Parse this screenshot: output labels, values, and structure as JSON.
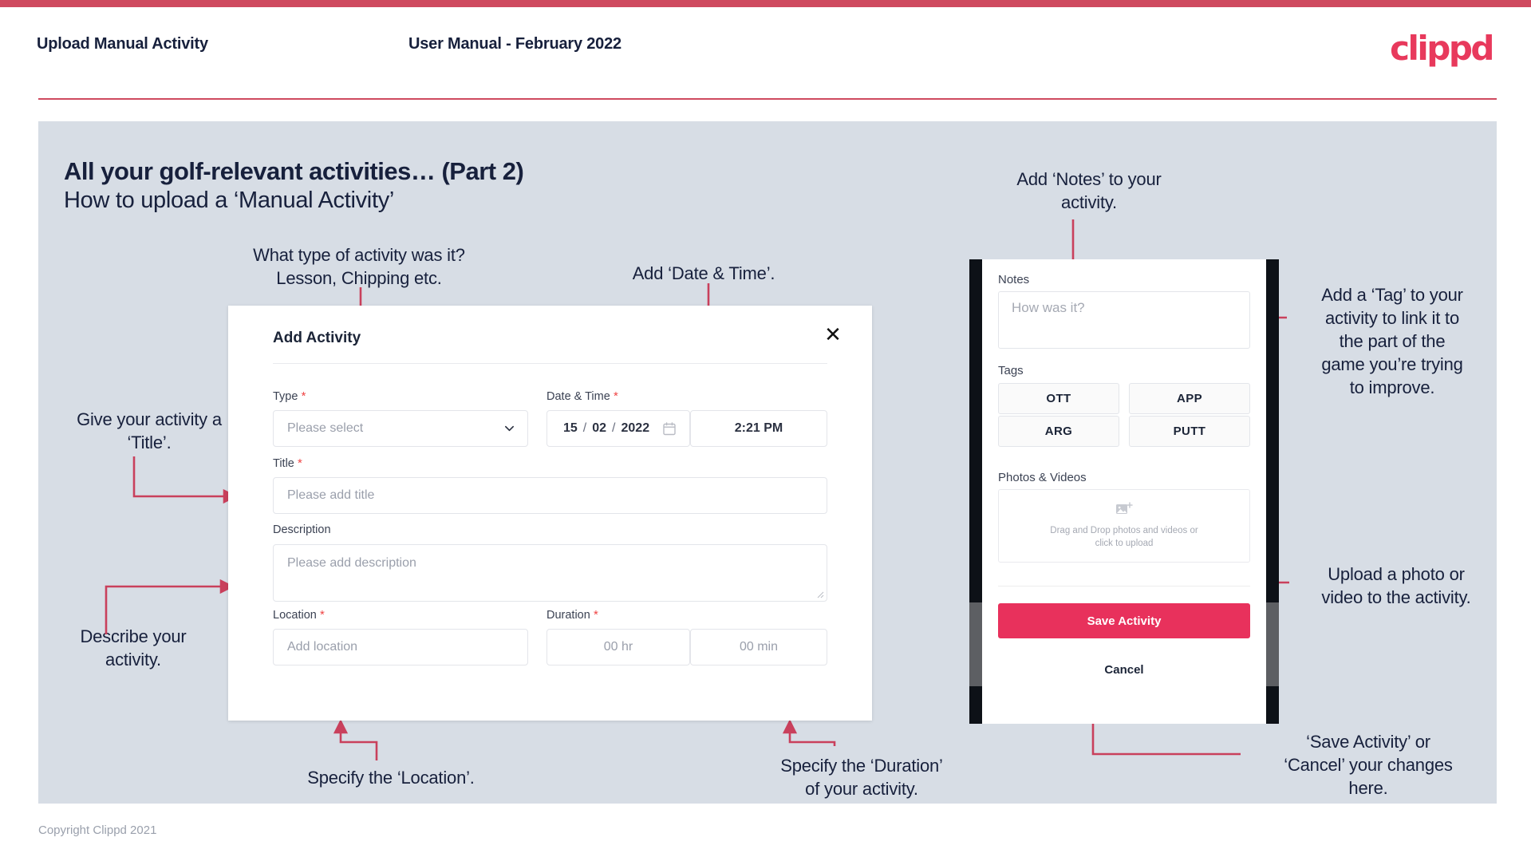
{
  "header": {
    "title": "Upload Manual Activity",
    "subtitle": "User Manual - February 2022",
    "logo": "clippd"
  },
  "slide": {
    "title": "All your golf-relevant activities… (Part 2)",
    "subtitle": "How to upload a ‘Manual Activity’"
  },
  "annotations": {
    "type": "What type of activity was it?\nLesson, Chipping etc.",
    "datetime": "Add ‘Date & Time’.",
    "title": "Give your activity a\n‘Title’.",
    "description": "Describe your\nactivity.",
    "location": "Specify the ‘Location’.",
    "duration": "Specify the ‘Duration’\nof your activity.",
    "notes": "Add ‘Notes’ to your\nactivity.",
    "tags": "Add a ‘Tag’ to your\nactivity to link it to\nthe part of the\ngame you’re trying\nto improve.",
    "photos": "Upload a photo or\nvideo to the activity.",
    "save": "‘Save Activity’ or\n‘Cancel’ your changes\nhere."
  },
  "dialog": {
    "title": "Add Activity",
    "close_icon": "close-icon",
    "fields": {
      "type": {
        "label": "Type",
        "required": true,
        "placeholder": "Please select"
      },
      "datetime": {
        "label": "Date & Time",
        "required": true,
        "day": "15",
        "month": "02",
        "year": "2022",
        "sep": "/",
        "time": "2:21 PM"
      },
      "title": {
        "label": "Title",
        "required": true,
        "placeholder": "Please add title"
      },
      "description": {
        "label": "Description",
        "required": false,
        "placeholder": "Please add description"
      },
      "location": {
        "label": "Location",
        "required": true,
        "placeholder": "Add location"
      },
      "duration": {
        "label": "Duration",
        "required": true,
        "hours": "00 hr",
        "minutes": "00 min"
      }
    }
  },
  "mobile": {
    "notes": {
      "label": "Notes",
      "placeholder": "How was it?"
    },
    "tags": {
      "label": "Tags",
      "options": [
        "OTT",
        "APP",
        "ARG",
        "PUTT"
      ]
    },
    "photos": {
      "label": "Photos & Videos",
      "dropzone": "Drag and Drop photos and videos or\nclick to upload"
    },
    "save_label": "Save Activity",
    "cancel_label": "Cancel"
  },
  "footer": {
    "copyright": "Copyright Clippd 2021"
  },
  "colors": {
    "brand_pink": "#e8395c",
    "top_bar": "#cf4a5f",
    "slide_bg": "#d7dde5",
    "ink": "#17203c",
    "connector": "#c9405c"
  }
}
